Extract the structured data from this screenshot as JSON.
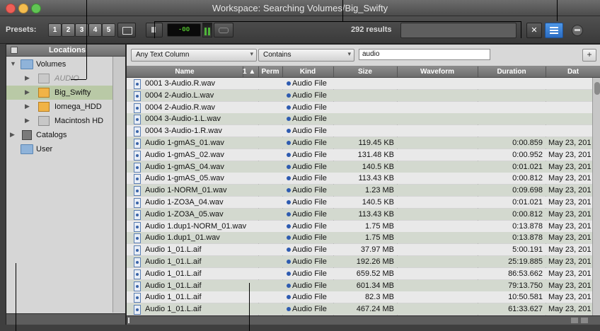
{
  "window": {
    "title": "Workspace: Searching Volumes/Big_Swifty"
  },
  "toolbar": {
    "presets_label": "Presets:",
    "presets": [
      "1",
      "2",
      "3",
      "4",
      "5"
    ],
    "meter_value": "-00",
    "results": "292 results",
    "search_placeholder": "",
    "clear_symbol": "✕"
  },
  "sidebar": {
    "header": "Locations",
    "items": [
      {
        "label": "Volumes",
        "expanded": true,
        "icon": "folder-icon"
      },
      {
        "label": "AUDIO",
        "disabled": true,
        "icon": "drive-icon"
      },
      {
        "label": "Big_Swifty",
        "selected": true,
        "icon": "drive-icon"
      },
      {
        "label": "Iomega_HDD",
        "icon": "drive-icon"
      },
      {
        "label": "Macintosh HD",
        "icon": "drive-icon"
      },
      {
        "label": "Catalogs",
        "icon": "catalog-icon"
      },
      {
        "label": "User",
        "icon": "folder-icon"
      }
    ]
  },
  "filters": {
    "column": "Any Text Column",
    "operator": "Contains",
    "value": "audio",
    "add_symbol": "+"
  },
  "columns": [
    {
      "label": "Name"
    },
    {
      "label": "1 ▲"
    },
    {
      "label": "Perm"
    },
    {
      "label": "Kind"
    },
    {
      "label": "Size"
    },
    {
      "label": "Waveform"
    },
    {
      "label": "Duration"
    },
    {
      "label": "Dat"
    }
  ],
  "rows": [
    {
      "name": "0001 3-Audio.R.wav",
      "kind": "Audio File",
      "size": "",
      "duration": "",
      "date": ""
    },
    {
      "name": "0004 2-Audio.L.wav",
      "kind": "Audio File",
      "size": "",
      "duration": "",
      "date": ""
    },
    {
      "name": "0004 2-Audio.R.wav",
      "kind": "Audio File",
      "size": "",
      "duration": "",
      "date": ""
    },
    {
      "name": "0004 3-Audio-1.L.wav",
      "kind": "Audio File",
      "size": "",
      "duration": "",
      "date": ""
    },
    {
      "name": "0004 3-Audio-1.R.wav",
      "kind": "Audio File",
      "size": "",
      "duration": "",
      "date": ""
    },
    {
      "name": "Audio 1-gmAS_01.wav",
      "kind": "Audio File",
      "size": "119.45 KB",
      "duration": "0:00.859",
      "date": "May 23, 201"
    },
    {
      "name": "Audio 1-gmAS_02.wav",
      "kind": "Audio File",
      "size": "131.48 KB",
      "duration": "0:00.952",
      "date": "May 23, 201"
    },
    {
      "name": "Audio 1-gmAS_04.wav",
      "kind": "Audio File",
      "size": "140.5 KB",
      "duration": "0:01.021",
      "date": "May 23, 201"
    },
    {
      "name": "Audio 1-gmAS_05.wav",
      "kind": "Audio File",
      "size": "113.43 KB",
      "duration": "0:00.812",
      "date": "May 23, 201"
    },
    {
      "name": "Audio 1-NORM_01.wav",
      "kind": "Audio File",
      "size": "1.23 MB",
      "duration": "0:09.698",
      "date": "May 23, 201"
    },
    {
      "name": "Audio 1-ZO3A_04.wav",
      "kind": "Audio File",
      "size": "140.5 KB",
      "duration": "0:01.021",
      "date": "May 23, 201"
    },
    {
      "name": "Audio 1-ZO3A_05.wav",
      "kind": "Audio File",
      "size": "113.43 KB",
      "duration": "0:00.812",
      "date": "May 23, 201"
    },
    {
      "name": "Audio 1.dup1-NORM_01.wav",
      "kind": "Audio File",
      "size": "1.75 MB",
      "duration": "0:13.878",
      "date": "May 23, 201"
    },
    {
      "name": "Audio 1.dup1_01.wav",
      "kind": "Audio File",
      "size": "1.75 MB",
      "duration": "0:13.878",
      "date": "May 23, 201"
    },
    {
      "name": "Audio 1_01.L.aif",
      "kind": "Audio File",
      "size": "37.97 MB",
      "duration": "5:00.191",
      "date": "May 23, 201"
    },
    {
      "name": "Audio 1_01.L.aif",
      "kind": "Audio File",
      "size": "192.26 MB",
      "duration": "25:19.885",
      "date": "May 23, 201"
    },
    {
      "name": "Audio 1_01.L.aif",
      "kind": "Audio File",
      "size": "659.52 MB",
      "duration": "86:53.662",
      "date": "May 23, 201"
    },
    {
      "name": "Audio 1_01.L.aif",
      "kind": "Audio File",
      "size": "601.34 MB",
      "duration": "79:13.750",
      "date": "May 23, 201"
    },
    {
      "name": "Audio 1_01.L.aif",
      "kind": "Audio File",
      "size": "82.3 MB",
      "duration": "10:50.581",
      "date": "May 23, 201"
    },
    {
      "name": "Audio 1_01.L.aif",
      "kind": "Audio File",
      "size": "467.24 MB",
      "duration": "61:33.627",
      "date": "May 23, 201"
    }
  ]
}
